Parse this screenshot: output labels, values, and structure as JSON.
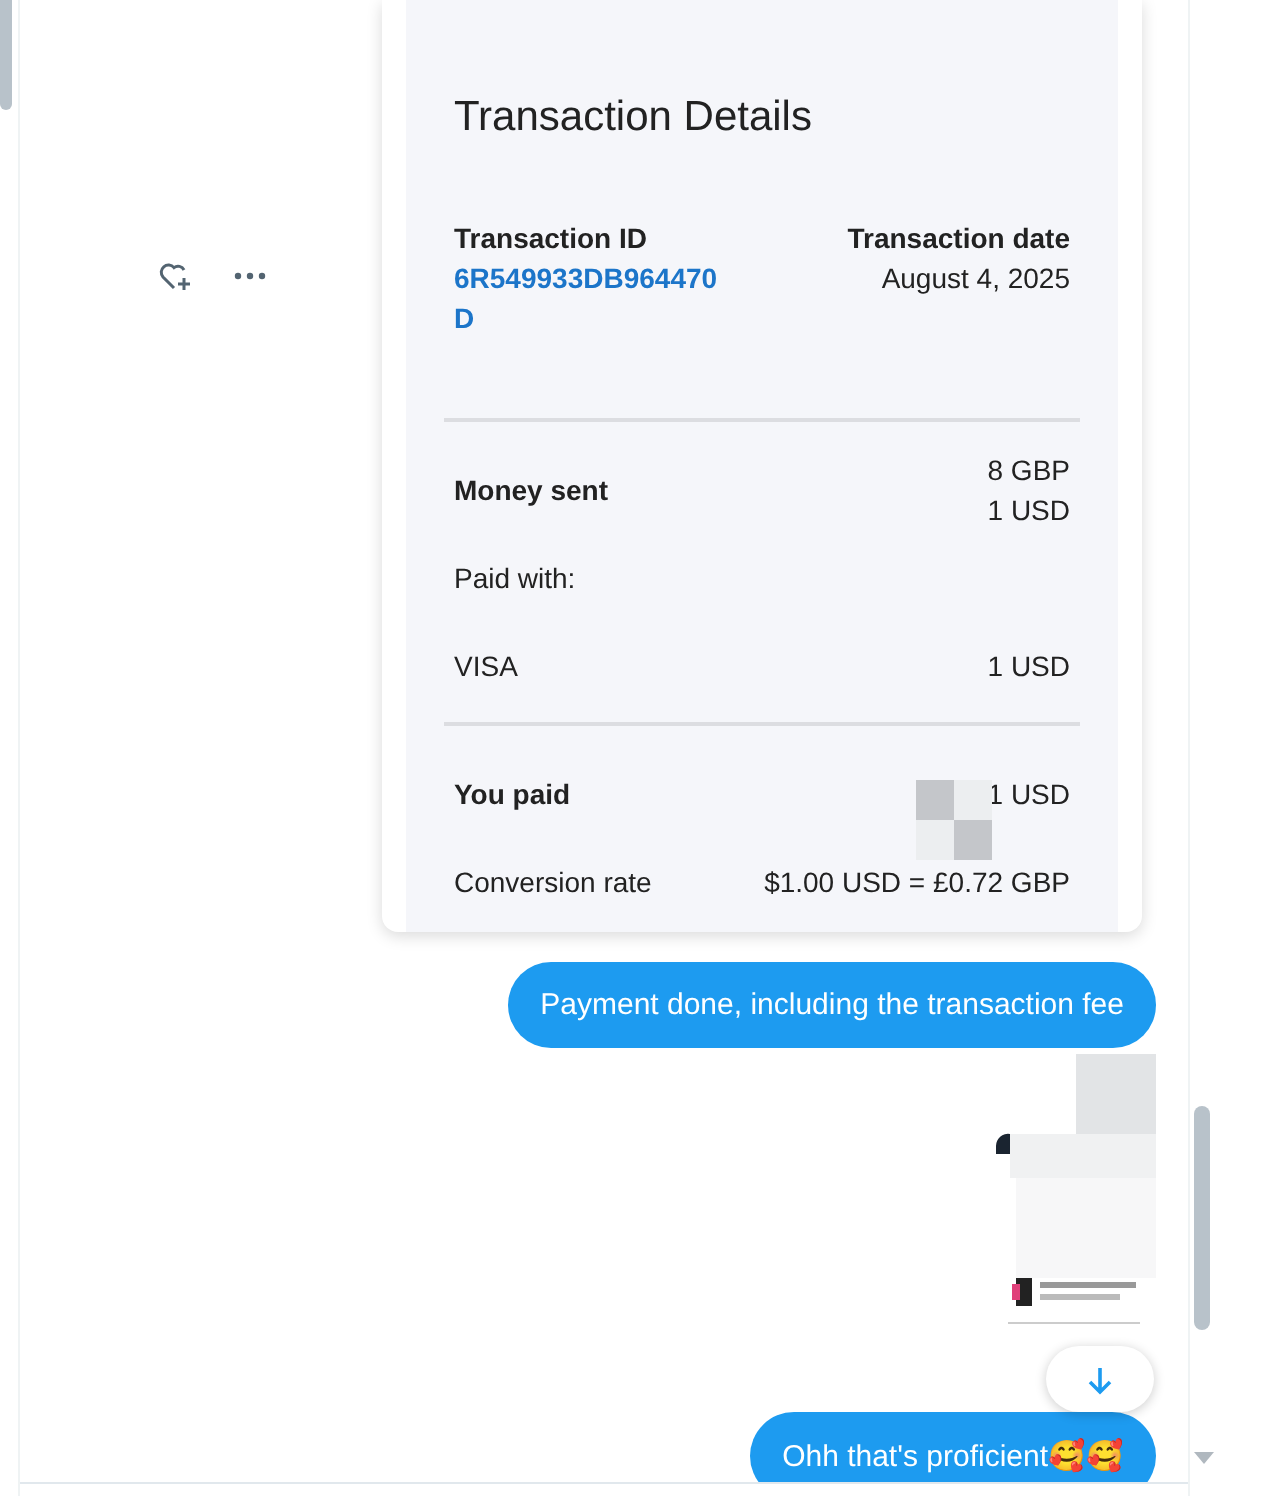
{
  "conversation": {
    "messages": [
      {
        "kind": "transaction_image",
        "title": "Transaction Details",
        "id_label": "Transaction ID",
        "id_value": "6R549933DB964470D",
        "date_label": "Transaction date",
        "date_value": "August 4, 2025",
        "rows": [
          {
            "label": "Money sent",
            "values": [
              "8 GBP",
              "1 USD"
            ],
            "bold": true,
            "divider_before": true
          },
          {
            "label": "Paid with:",
            "values": [],
            "bold": false,
            "divider_before": false
          },
          {
            "label": "VISA",
            "values": [
              "1 USD"
            ],
            "bold": false,
            "divider_before": false
          },
          {
            "label": "You paid",
            "values": [
              "1 USD"
            ],
            "bold": true,
            "divider_before": true
          },
          {
            "label": "Conversion rate",
            "values": [
              "$1.00 USD = £0.72 GBP"
            ],
            "bold": false,
            "divider_before": false
          }
        ]
      },
      {
        "kind": "text",
        "text": "Payment done, including the transaction fee"
      },
      {
        "kind": "picture"
      },
      {
        "kind": "text",
        "text": "Ohh that's proficient🥰🥰"
      }
    ]
  }
}
